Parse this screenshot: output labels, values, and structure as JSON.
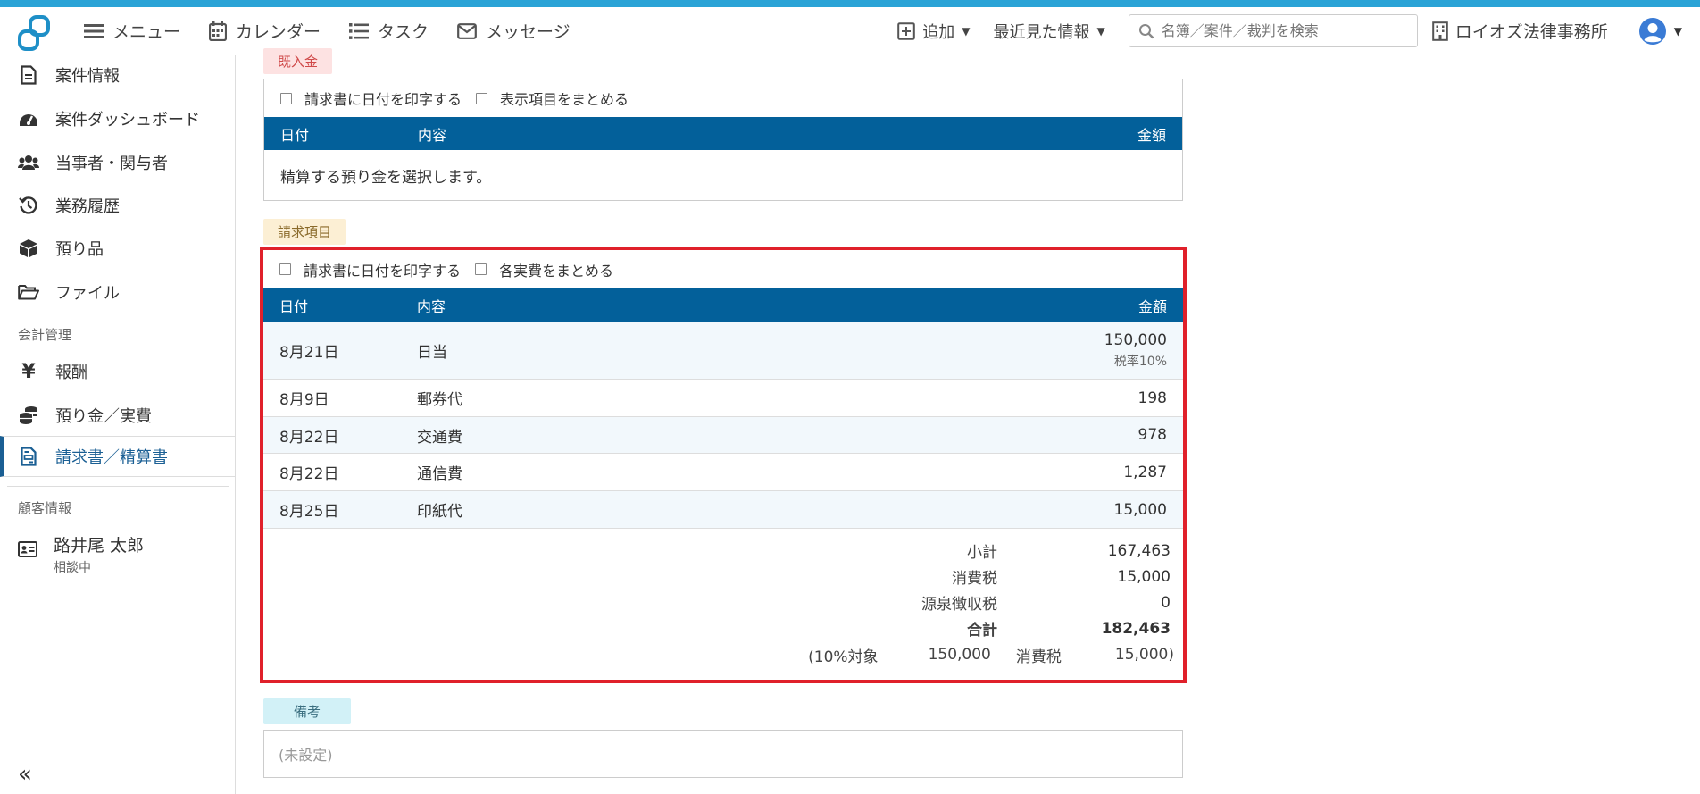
{
  "header": {
    "nav": [
      {
        "label": "メニュー",
        "icon": "menu-icon"
      },
      {
        "label": "カレンダー",
        "icon": "calendar-icon"
      },
      {
        "label": "タスク",
        "icon": "task-list-icon"
      },
      {
        "label": "メッセージ",
        "icon": "envelope-icon"
      }
    ],
    "add_label": "追加",
    "recent_label": "最近見た情報",
    "search_placeholder": "名簿／案件／裁判を検索",
    "firm_name": "ロイオズ法律事務所"
  },
  "sidebar": {
    "items": [
      {
        "label": "案件情報",
        "icon": "document-icon"
      },
      {
        "label": "案件ダッシュボード",
        "icon": "gauge-icon"
      },
      {
        "label": "当事者・関与者",
        "icon": "users-icon"
      },
      {
        "label": "業務履歴",
        "icon": "history-icon"
      },
      {
        "label": "預り品",
        "icon": "box-icon"
      },
      {
        "label": "ファイル",
        "icon": "folder-icon"
      }
    ],
    "section_accounting": "会計管理",
    "accounting_items": [
      {
        "label": "報酬",
        "icon": "yen-icon"
      },
      {
        "label": "預り金／実費",
        "icon": "coins-icon"
      },
      {
        "label": "請求書／精算書",
        "icon": "invoice-icon",
        "active": true
      }
    ],
    "section_client": "顧客情報",
    "client": {
      "name": "路井尾 太郎",
      "status": "相談中"
    }
  },
  "deposit_section": {
    "tag": "既入金",
    "check_print_date": "請求書に日付を印字する",
    "check_group": "表示項目をまとめる",
    "columns": {
      "date": "日付",
      "desc": "内容",
      "amount": "金額"
    },
    "empty_text": "精算する預り金を選択します。"
  },
  "billing_section": {
    "tag": "請求項目",
    "check_print_date": "請求書に日付を印字する",
    "check_group": "各実費をまとめる",
    "columns": {
      "date": "日付",
      "desc": "内容",
      "amount": "金額"
    },
    "rows": [
      {
        "date": "8月21日",
        "desc": "日当",
        "amount": "150,000",
        "note": "税率10%"
      },
      {
        "date": "8月9日",
        "desc": "郵券代",
        "amount": "198"
      },
      {
        "date": "8月22日",
        "desc": "交通費",
        "amount": "978"
      },
      {
        "date": "8月22日",
        "desc": "通信費",
        "amount": "1,287"
      },
      {
        "date": "8月25日",
        "desc": "印紙代",
        "amount": "15,000"
      }
    ],
    "totals": {
      "subtotal_label": "小計",
      "subtotal": "167,463",
      "tax_label": "消費税",
      "tax": "15,000",
      "withholding_label": "源泉徴収税",
      "withholding": "0",
      "total_label": "合計",
      "total": "182,463"
    },
    "tax_breakdown": {
      "target_label": "(10%対象",
      "target_amount": "150,000",
      "tax_label": "消費税",
      "tax_amount": "15,000)"
    }
  },
  "memo_section": {
    "tag": "備考",
    "value": "(未設定)"
  }
}
